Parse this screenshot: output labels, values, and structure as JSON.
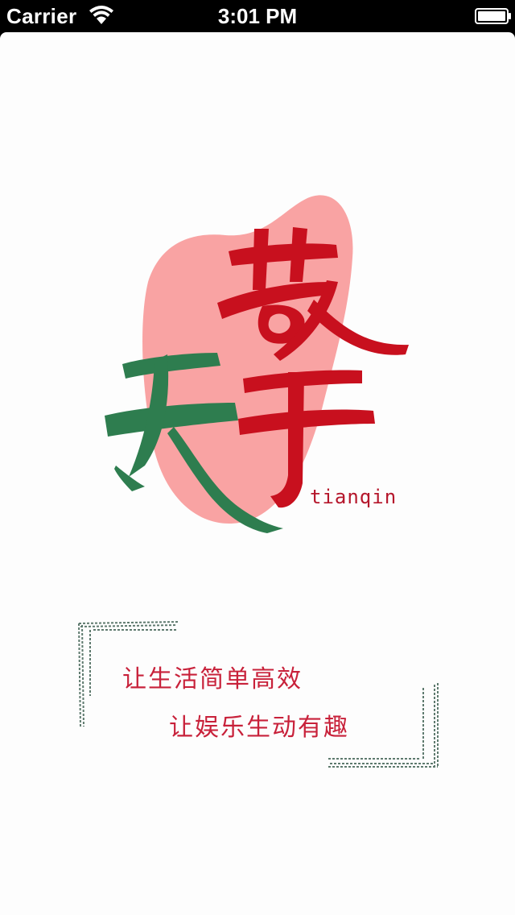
{
  "status_bar": {
    "carrier": "Carrier",
    "time": "3:01 PM",
    "wifi_icon": "wifi-icon",
    "battery_icon": "battery-icon"
  },
  "splash": {
    "logo": {
      "chars": [
        "天",
        "擎"
      ],
      "romanization": "tianqin",
      "colors": {
        "blob": "#f9a3a3",
        "tian": "#2e7d4f",
        "qin": "#c8101e"
      }
    },
    "slogan": {
      "line1": "让生活简单高效",
      "line2": "让娱乐生动有趣",
      "color": "#c8213a",
      "frame_color": "#5e7a6e"
    }
  }
}
